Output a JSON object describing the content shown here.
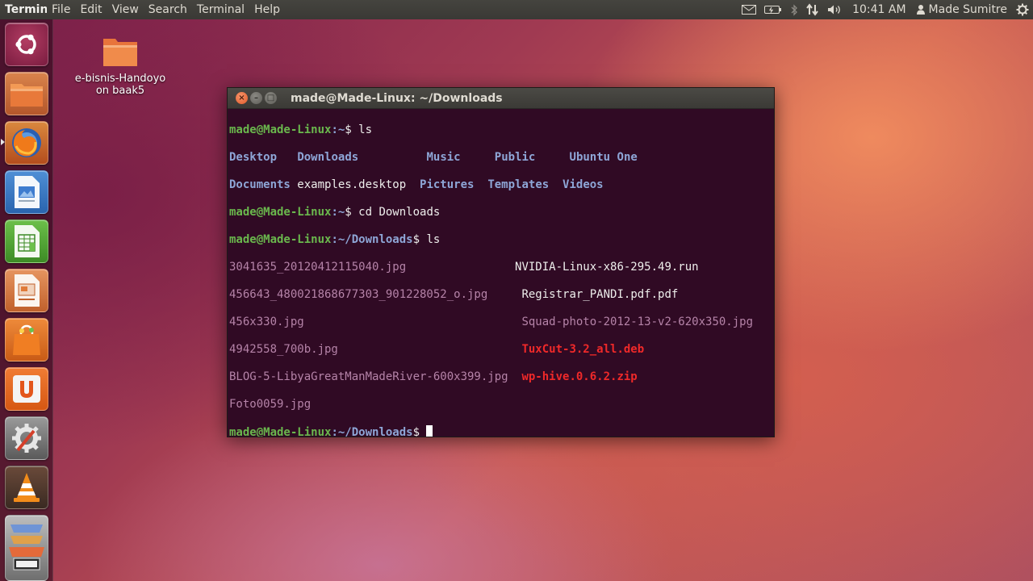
{
  "top_panel": {
    "app_title": "Terminal",
    "menus": [
      "File",
      "Edit",
      "View",
      "Search",
      "Terminal",
      "Help"
    ],
    "clock": "10:41 AM",
    "user": "Made Sumitre"
  },
  "desktop": {
    "icon_label_line1": "e-bisnis-Handoyo",
    "icon_label_line2": "on baak5"
  },
  "launcher": {
    "items": [
      "dash-home",
      "files",
      "firefox",
      "writer",
      "calc",
      "impress",
      "software-center",
      "ubuntu-one",
      "system-settings",
      "vlc",
      "more-apps"
    ]
  },
  "terminal": {
    "window_title": "made@Made-Linux: ~/Downloads",
    "prompt_user": "made@Made-Linux",
    "home_path": ":~",
    "dl_path": ":~/Downloads",
    "dollar": "$ ",
    "cmd1": "ls",
    "cmd2": "cd Downloads",
    "cmd3": "ls",
    "home_listing": [
      [
        "Desktop",
        "Downloads",
        "Music",
        "Public",
        "Ubuntu One"
      ],
      [
        "Documents",
        "examples.desktop",
        "Pictures",
        "Templates",
        "Videos"
      ]
    ],
    "download_listing_left": [
      "3041635_20120412115040.jpg",
      "456643_480021868677303_901228052_o.jpg",
      "456x330.jpg",
      "4942558_700b.jpg",
      "BLOG-5-LibyaGreatManMadeRiver-600x399.jpg",
      "Foto0059.jpg"
    ],
    "download_listing_right": [
      "NVIDIA-Linux-x86-295.49.run",
      "Registrar_PANDI.pdf.pdf",
      "Squad-photo-2012-13-v2-620x350.jpg",
      "TuxCut-3.2_all.deb",
      "wp-hive.0.6.2.zip"
    ]
  },
  "colors": {
    "terminal_bg": "#300a24",
    "prompt_green": "#6ab84d",
    "directory_blue": "#8ea6d7",
    "image_magenta": "#b583a8",
    "archive_red": "#ef2929"
  }
}
